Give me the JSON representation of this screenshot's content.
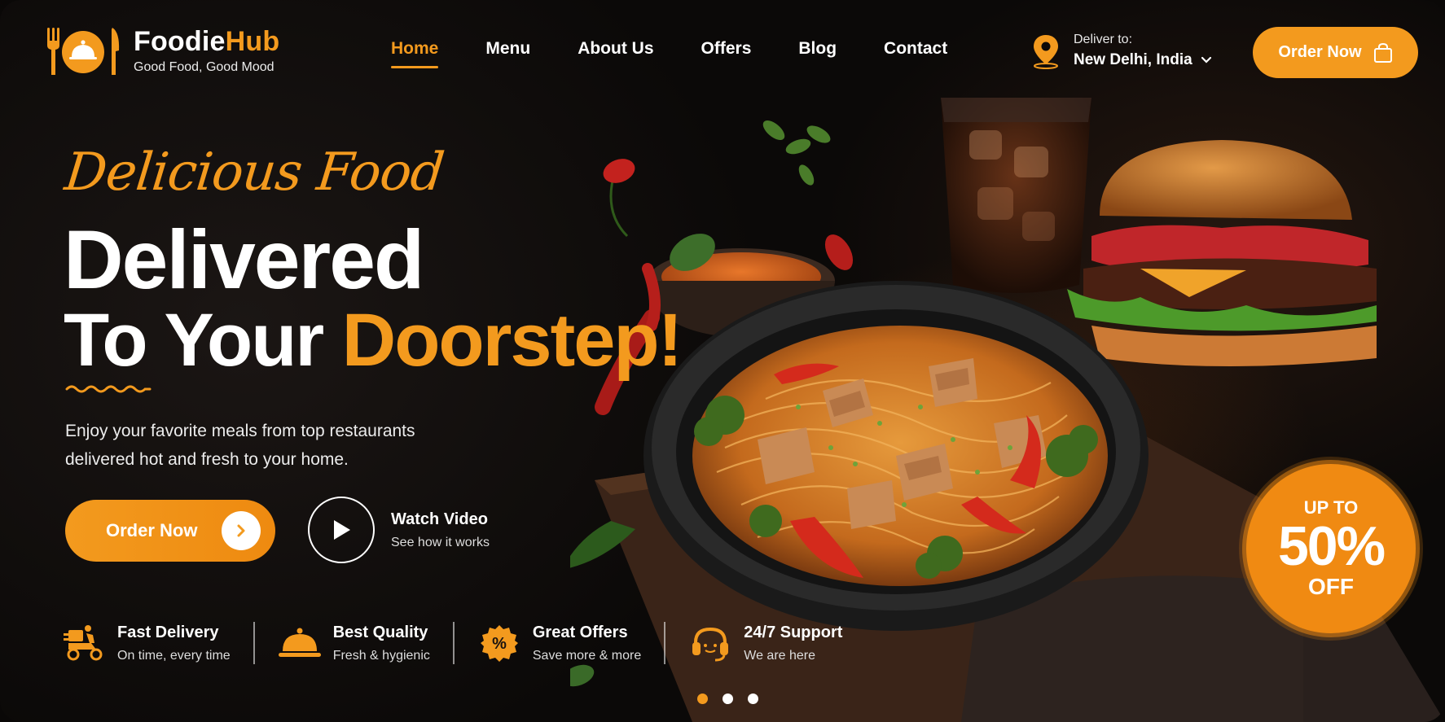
{
  "brand": {
    "name_main": "Foodie",
    "name_accent": "Hub",
    "tagline": "Good Food, Good Mood"
  },
  "nav": {
    "items": [
      {
        "label": "Home",
        "active": true
      },
      {
        "label": "Menu",
        "active": false
      },
      {
        "label": "About Us",
        "active": false
      },
      {
        "label": "Offers",
        "active": false
      },
      {
        "label": "Blog",
        "active": false
      },
      {
        "label": "Contact",
        "active": false
      }
    ],
    "deliver_label": "Deliver to:",
    "deliver_value": "New Delhi, India",
    "order_button": "Order Now"
  },
  "hero": {
    "script_title": "Delicious Food",
    "headline_line1": "Delivered",
    "headline_line2_white": "To Your ",
    "headline_line2_accent": "Doorstep!",
    "subtext": "Enjoy your favorite meals from top restaurants delivered hot and fresh to your home.",
    "cta_order": "Order Now",
    "watch_title": "Watch Video",
    "watch_sub": "See how it works"
  },
  "features": [
    {
      "title": "Fast Delivery",
      "sub": "On time, every time",
      "icon": "delivery-scooter-icon"
    },
    {
      "title": "Best Quality",
      "sub": "Fresh & hygienic",
      "icon": "cloche-icon"
    },
    {
      "title": "Great Offers",
      "sub": "Save more & more",
      "icon": "discount-badge-icon"
    },
    {
      "title": "24/7 Support",
      "sub": "We are here",
      "icon": "headset-icon"
    }
  ],
  "badge": {
    "line1": "UP TO",
    "line2": "50%",
    "line3": "OFF"
  },
  "carousel": {
    "count": 3,
    "active_index": 0
  },
  "colors": {
    "accent": "#f39a1e",
    "background": "#0b0908",
    "text": "#ffffff"
  }
}
